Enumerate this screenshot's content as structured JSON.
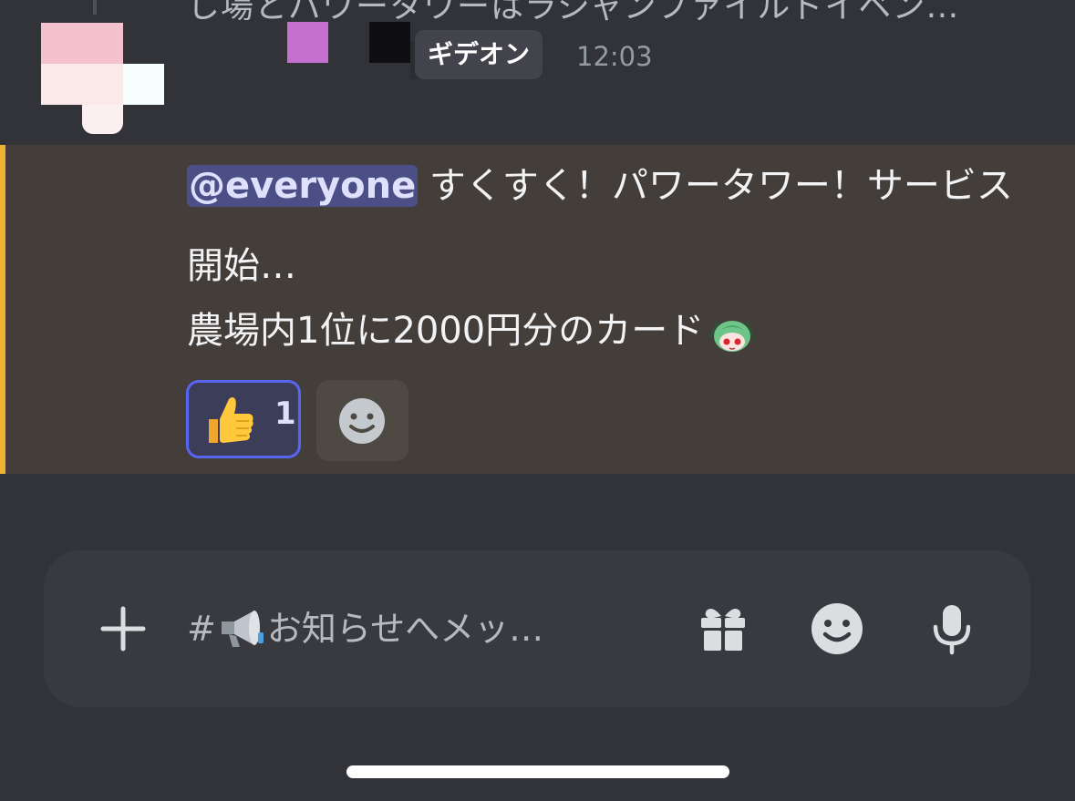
{
  "previous_message": {
    "text": "し場とパワータワーはラジャンファイルドイベン…"
  },
  "message": {
    "author_role_badge": "ギデオン",
    "timestamp": "12:03",
    "mention": "@everyone",
    "line1": " すくすく！パワータワー！サービス開始…",
    "line2": "農場内1位に2000円分のカード",
    "reaction": {
      "emoji": "thumbs-up",
      "count": "1"
    }
  },
  "composer": {
    "channel_prefix": "#",
    "placeholder": "お知らせへメッ…"
  },
  "colors": {
    "background": "#313338",
    "mention_highlight": "#443e3a",
    "mention_bar": "#f0b232",
    "reaction_border": "#5865f2",
    "composer": "#383a40"
  },
  "icons": {
    "composer_add": "plus-icon",
    "composer_gift": "gift-icon",
    "composer_emoji": "emoji-icon",
    "composer_mic": "microphone-icon",
    "add_reaction": "add-reaction-icon",
    "channel": "megaphone-icon"
  }
}
